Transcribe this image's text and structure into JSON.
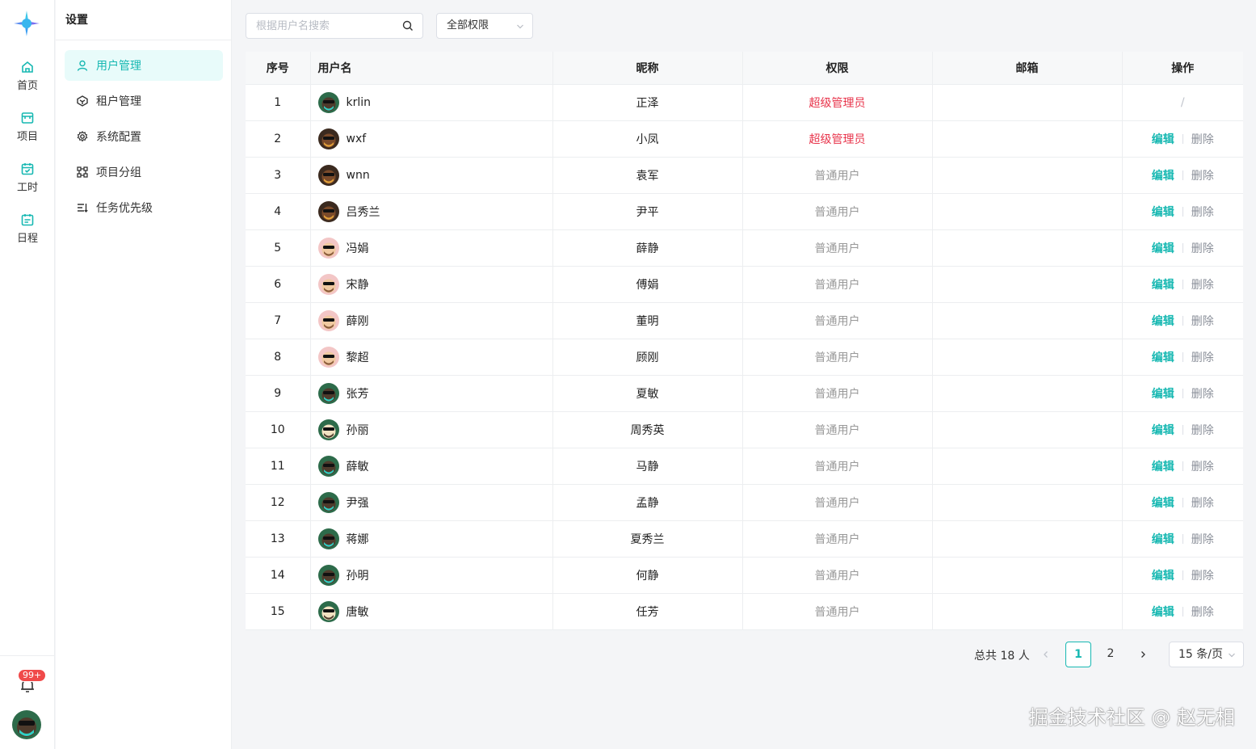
{
  "colors": {
    "accent": "#17b8b2",
    "super_admin": "#e8344b",
    "normal": "#999999",
    "badge": "#f04a4a"
  },
  "rail": {
    "items": [
      {
        "label": "首页",
        "icon": "home-icon"
      },
      {
        "label": "项目",
        "icon": "project-icon"
      },
      {
        "label": "工时",
        "icon": "timesheet-icon"
      },
      {
        "label": "日程",
        "icon": "schedule-icon"
      }
    ],
    "notification_badge": "99+"
  },
  "settings": {
    "title": "设置",
    "menu": [
      {
        "label": "用户管理",
        "icon": "user-icon",
        "active": true
      },
      {
        "label": "租户管理",
        "icon": "tenant-icon",
        "active": false
      },
      {
        "label": "系统配置",
        "icon": "gear-icon",
        "active": false
      },
      {
        "label": "项目分组",
        "icon": "group-icon",
        "active": false
      },
      {
        "label": "任务优先级",
        "icon": "priority-icon",
        "active": false
      }
    ]
  },
  "filters": {
    "search_placeholder": "根据用户名搜索",
    "role_select": "全部权限"
  },
  "table": {
    "headers": {
      "index": "序号",
      "username": "用户名",
      "nickname": "昵称",
      "role": "权限",
      "email": "邮箱",
      "actions": "操作"
    },
    "edit_label": "编辑",
    "delete_label": "删除",
    "no_action": "/",
    "rows": [
      {
        "index": "1",
        "username": "krlin",
        "nickname": "正泽",
        "role": "超级管理员",
        "role_type": "super",
        "email": "",
        "actions": "none",
        "avatar": "green"
      },
      {
        "index": "2",
        "username": "wxf",
        "nickname": "小凤",
        "role": "超级管理员",
        "role_type": "super",
        "email": "",
        "actions": "full",
        "avatar": "brown"
      },
      {
        "index": "3",
        "username": "wnn",
        "nickname": "袁军",
        "role": "普通用户",
        "role_type": "normal",
        "email": "",
        "actions": "full",
        "avatar": "brown"
      },
      {
        "index": "4",
        "username": "吕秀兰",
        "nickname": "尹平",
        "role": "普通用户",
        "role_type": "normal",
        "email": "",
        "actions": "full",
        "avatar": "brown"
      },
      {
        "index": "5",
        "username": "冯娟",
        "nickname": "薛静",
        "role": "普通用户",
        "role_type": "normal",
        "email": "",
        "actions": "full",
        "avatar": "pink"
      },
      {
        "index": "6",
        "username": "宋静",
        "nickname": "傅娟",
        "role": "普通用户",
        "role_type": "normal",
        "email": "",
        "actions": "full",
        "avatar": "pink"
      },
      {
        "index": "7",
        "username": "薛刚",
        "nickname": "董明",
        "role": "普通用户",
        "role_type": "normal",
        "email": "",
        "actions": "full",
        "avatar": "pink"
      },
      {
        "index": "8",
        "username": "黎超",
        "nickname": "顾刚",
        "role": "普通用户",
        "role_type": "normal",
        "email": "",
        "actions": "full",
        "avatar": "pink"
      },
      {
        "index": "9",
        "username": "张芳",
        "nickname": "夏敏",
        "role": "普通用户",
        "role_type": "normal",
        "email": "",
        "actions": "full",
        "avatar": "green"
      },
      {
        "index": "10",
        "username": "孙丽",
        "nickname": "周秀英",
        "role": "普通用户",
        "role_type": "normal",
        "email": "",
        "actions": "full",
        "avatar": "light"
      },
      {
        "index": "11",
        "username": "薛敏",
        "nickname": "马静",
        "role": "普通用户",
        "role_type": "normal",
        "email": "",
        "actions": "full",
        "avatar": "green"
      },
      {
        "index": "12",
        "username": "尹强",
        "nickname": "孟静",
        "role": "普通用户",
        "role_type": "normal",
        "email": "",
        "actions": "full",
        "avatar": "green"
      },
      {
        "index": "13",
        "username": "蒋娜",
        "nickname": "夏秀兰",
        "role": "普通用户",
        "role_type": "normal",
        "email": "",
        "actions": "full",
        "avatar": "green"
      },
      {
        "index": "14",
        "username": "孙明",
        "nickname": "何静",
        "role": "普通用户",
        "role_type": "normal",
        "email": "",
        "actions": "full",
        "avatar": "green"
      },
      {
        "index": "15",
        "username": "唐敏",
        "nickname": "任芳",
        "role": "普通用户",
        "role_type": "normal",
        "email": "",
        "actions": "full",
        "avatar": "light"
      }
    ]
  },
  "pagination": {
    "total": "总共 18 人",
    "pages": [
      "1",
      "2"
    ],
    "current": "1",
    "page_size": "15 条/页"
  },
  "watermark": "掘金技术社区 @ 赵无相"
}
